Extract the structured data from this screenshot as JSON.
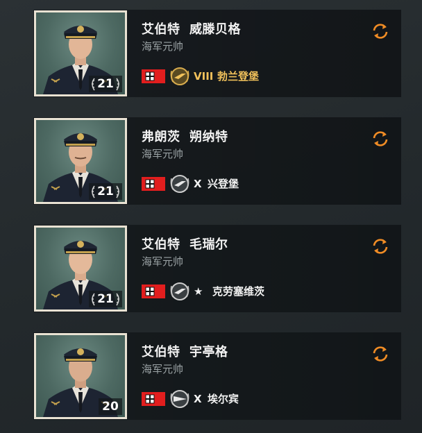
{
  "commanders": [
    {
      "name": "艾伯特  威滕贝格",
      "rank": "海军元帅",
      "level": "21",
      "ship_tier": "VIII",
      "ship_name": "勃兰登堡",
      "ship_text_color": "#f1c15b",
      "ship_emblem": "premium-ship-emblem-icon",
      "reset_icon": "refresh-icon"
    },
    {
      "name": "弗朗茨  朔纳特",
      "rank": "海军元帅",
      "level": "21",
      "ship_tier": "X",
      "ship_name": "兴登堡",
      "ship_text_color": "#f2f2f2",
      "ship_emblem": "ship-emblem-icon",
      "reset_icon": "refresh-icon"
    },
    {
      "name": "艾伯特  毛瑞尔",
      "rank": "海军元帅",
      "level": "21",
      "ship_tier": "★",
      "ship_name": "克劳塞维茨",
      "ship_text_color": "#f2f2f2",
      "ship_emblem": "ship-emblem-icon",
      "reset_icon": "refresh-icon"
    },
    {
      "name": "艾伯特  宇亭格",
      "rank": "海军元帅",
      "level": "20",
      "ship_tier": "X",
      "ship_name": "埃尔宾",
      "ship_text_color": "#f2f2f2",
      "ship_emblem": "destroyer-emblem-icon",
      "reset_icon": "refresh-icon"
    }
  ],
  "colors": {
    "accent_orange": "#f08c25",
    "flag_red": "#e21e1e",
    "premium_gold": "#f1c15b"
  }
}
